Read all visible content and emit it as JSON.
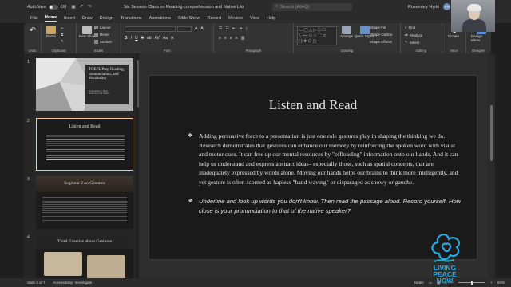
{
  "titlebar": {
    "autosave": "AutoSave",
    "autosave_state": "Off",
    "document_title": "Six Session Class on Reading comprehension and Native Like Pronuncia... • Last Modified: Yesterday at 2:37 PM",
    "search_placeholder": "Search (Alt+Q)",
    "user_name": "Rosemary Hyde",
    "avatar_initials": "RH"
  },
  "tabs": [
    "File",
    "Home",
    "Insert",
    "Draw",
    "Design",
    "Transitions",
    "Animations",
    "Slide Show",
    "Record",
    "Review",
    "View",
    "Help"
  ],
  "active_tab": "Home",
  "ribbon": {
    "undo": "Undo",
    "paste": "Paste",
    "clipboard": "Clipboard",
    "new_slide": "New Slide",
    "layout": "Layout",
    "reset": "Reset",
    "section": "Section",
    "slides": "Slides",
    "font": "Font",
    "paragraph": "Paragraph",
    "drawing": "Drawing",
    "arrange": "Arrange",
    "quick_styles": "Quick Styles",
    "shape_fill": "Shape Fill",
    "shape_outline": "Shape Outline",
    "shape_effects": "Shape Effects",
    "find": "Find",
    "replace": "Replace",
    "select": "Select",
    "editing": "Editing",
    "dictate": "Dictate",
    "voice": "Voice",
    "design_ideas": "Design Ideas",
    "designer": "Designer",
    "format_buttons": [
      "B",
      "I",
      "U",
      "S",
      "ab",
      "AV",
      "Aa",
      "A"
    ]
  },
  "thumbnails": [
    {
      "number": "1",
      "title": "TOEFL Prep Reading, pronunciation, and Vocabulary",
      "subtitle": "Dr. Rosemary C. Hyde\nIn Service of All Writers"
    },
    {
      "number": "2",
      "title": "Listen and Read"
    },
    {
      "number": "3",
      "title": "Segment 2 on Gestures"
    },
    {
      "number": "4",
      "title": "Third Exercise about Gestures"
    }
  ],
  "slide": {
    "title": "Listen and Read",
    "bullet1": "Adding persuasive force to a presentation is just one role gestures play in shaping the thinking we do. Research demonstrates that gestures can enhance our memory by reinforcing the spoken word with visual and motor cues. It can free up our mental resources by \"offloading\" information onto our hands. And it can help us understand and express abstract ideas– especially those, such as spatial concepts, that are inadequately expressed by words alone.  Moving our hands helps our brains to think more intelligently, and yet gesture is often scorned as hapless \"hand waving\" or disparaged as showy or gauche.",
    "bullet2": "Underline and look up words you don't know. Then read the passage aloud. Record yourself. How  close is your pronunciation to that of the native speaker?",
    "bullet_glyph": "❖"
  },
  "statusbar": {
    "slide_info": "Slide 2 of 7",
    "accessibility": "Accessibility: Investigate",
    "notes": "Notes",
    "zoom": "84%"
  },
  "logo": {
    "line1": "LIVING",
    "line2": "PEACE",
    "line3": "NOW"
  },
  "colors": {
    "accent": "#2aa9e0",
    "slide_bg": "#1a1a1a",
    "ribbon_bg": "#333333"
  }
}
